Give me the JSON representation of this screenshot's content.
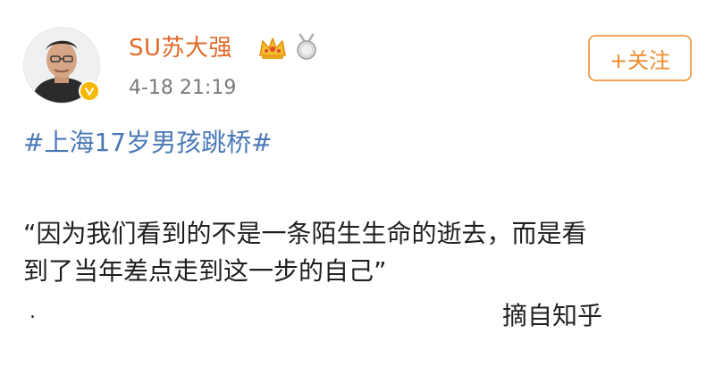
{
  "post": {
    "username": "SU苏大强",
    "timestamp": "4-18 21:19",
    "follow_button": "+关注",
    "hashtag": "#上海17岁男孩跳桥#",
    "content_line1": "“因为我们看到的不是一条陌生生命的逝去，而是看",
    "content_line2": "到了当年差点走到这一步的自己”",
    "dot": ".",
    "source": "摘自知乎"
  },
  "colors": {
    "username": "#e06a2a",
    "hashtag": "#4a78b6",
    "follow_border": "#f0a55a",
    "follow_text": "#ef8c2f",
    "verified_badge": "#f5b700"
  },
  "icons": {
    "verified": "verified-badge-icon",
    "crown": "crown-icon",
    "medal": "medal-icon"
  }
}
